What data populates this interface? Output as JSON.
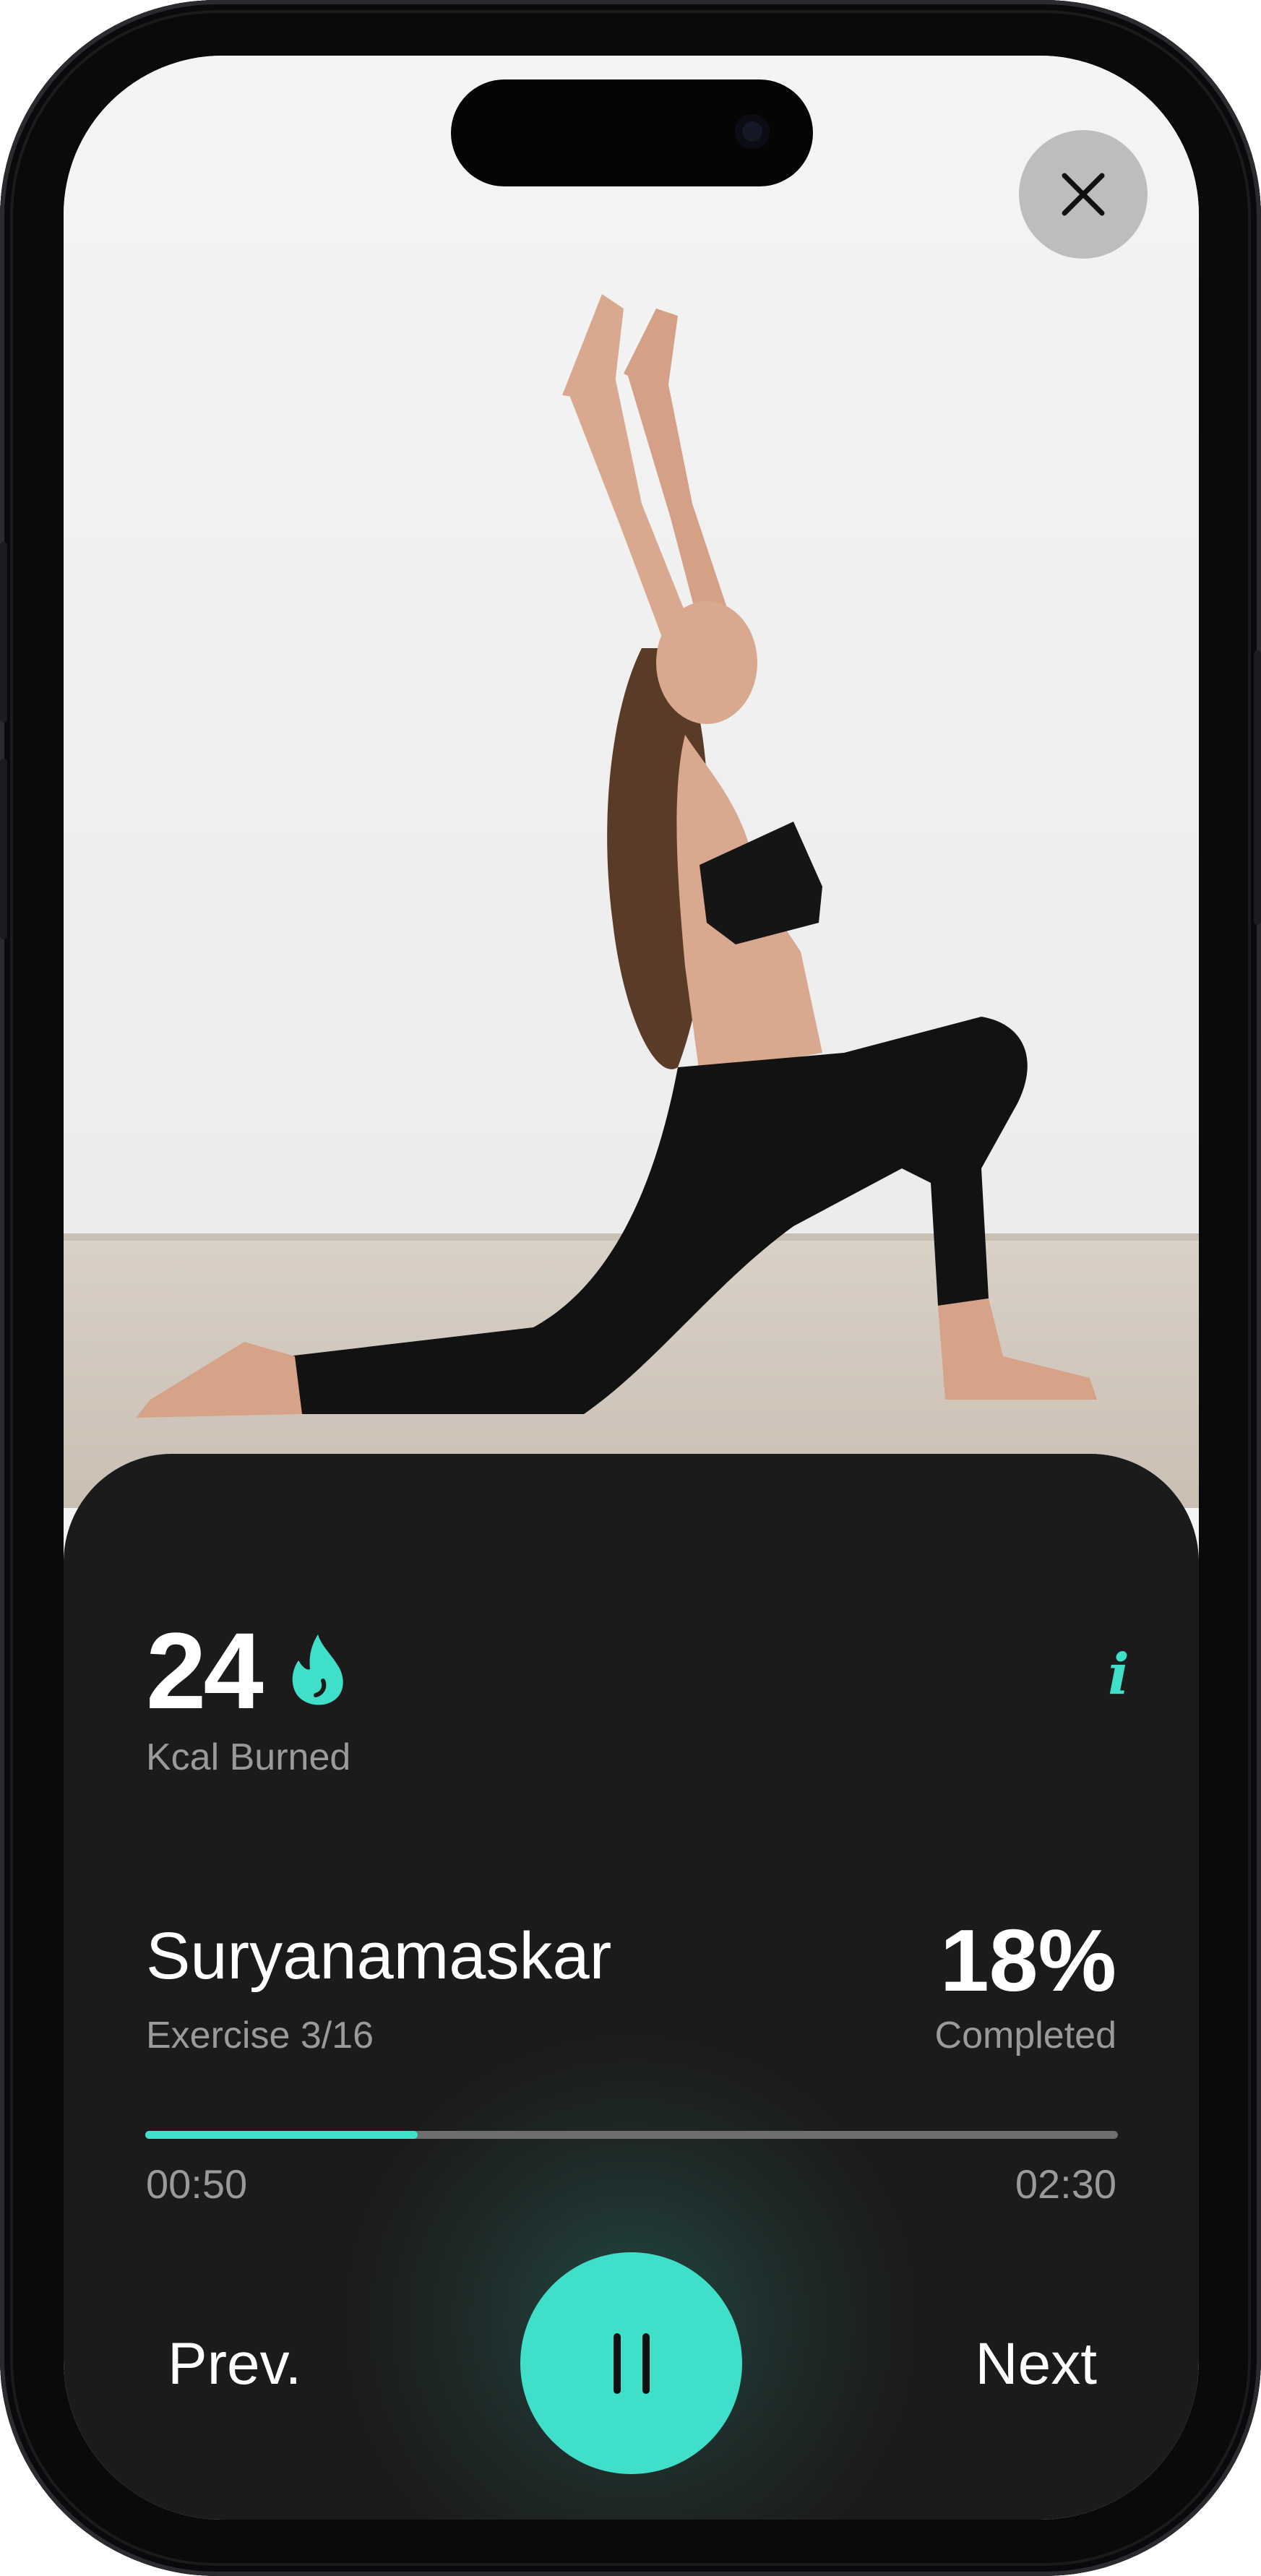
{
  "app": {
    "close_icon": "close-icon",
    "info_icon": "info-icon"
  },
  "stats": {
    "kcal_value": "24",
    "kcal_icon": "flame-drop-icon",
    "kcal_label": "Kcal Burned"
  },
  "exercise": {
    "name": "Suryanamaskar",
    "counter": "Exercise 3/16",
    "percent": "18%",
    "percent_label": "Completed"
  },
  "progress": {
    "elapsed": "00:50",
    "total": "02:30",
    "fraction": 0.28
  },
  "controls": {
    "prev_label": "Prev.",
    "next_label": "Next",
    "pause_icon": "pause-icon"
  },
  "colors": {
    "accent": "#40dfc9",
    "panel": "#1b1b1b",
    "muted_text": "#9a9a9a"
  }
}
